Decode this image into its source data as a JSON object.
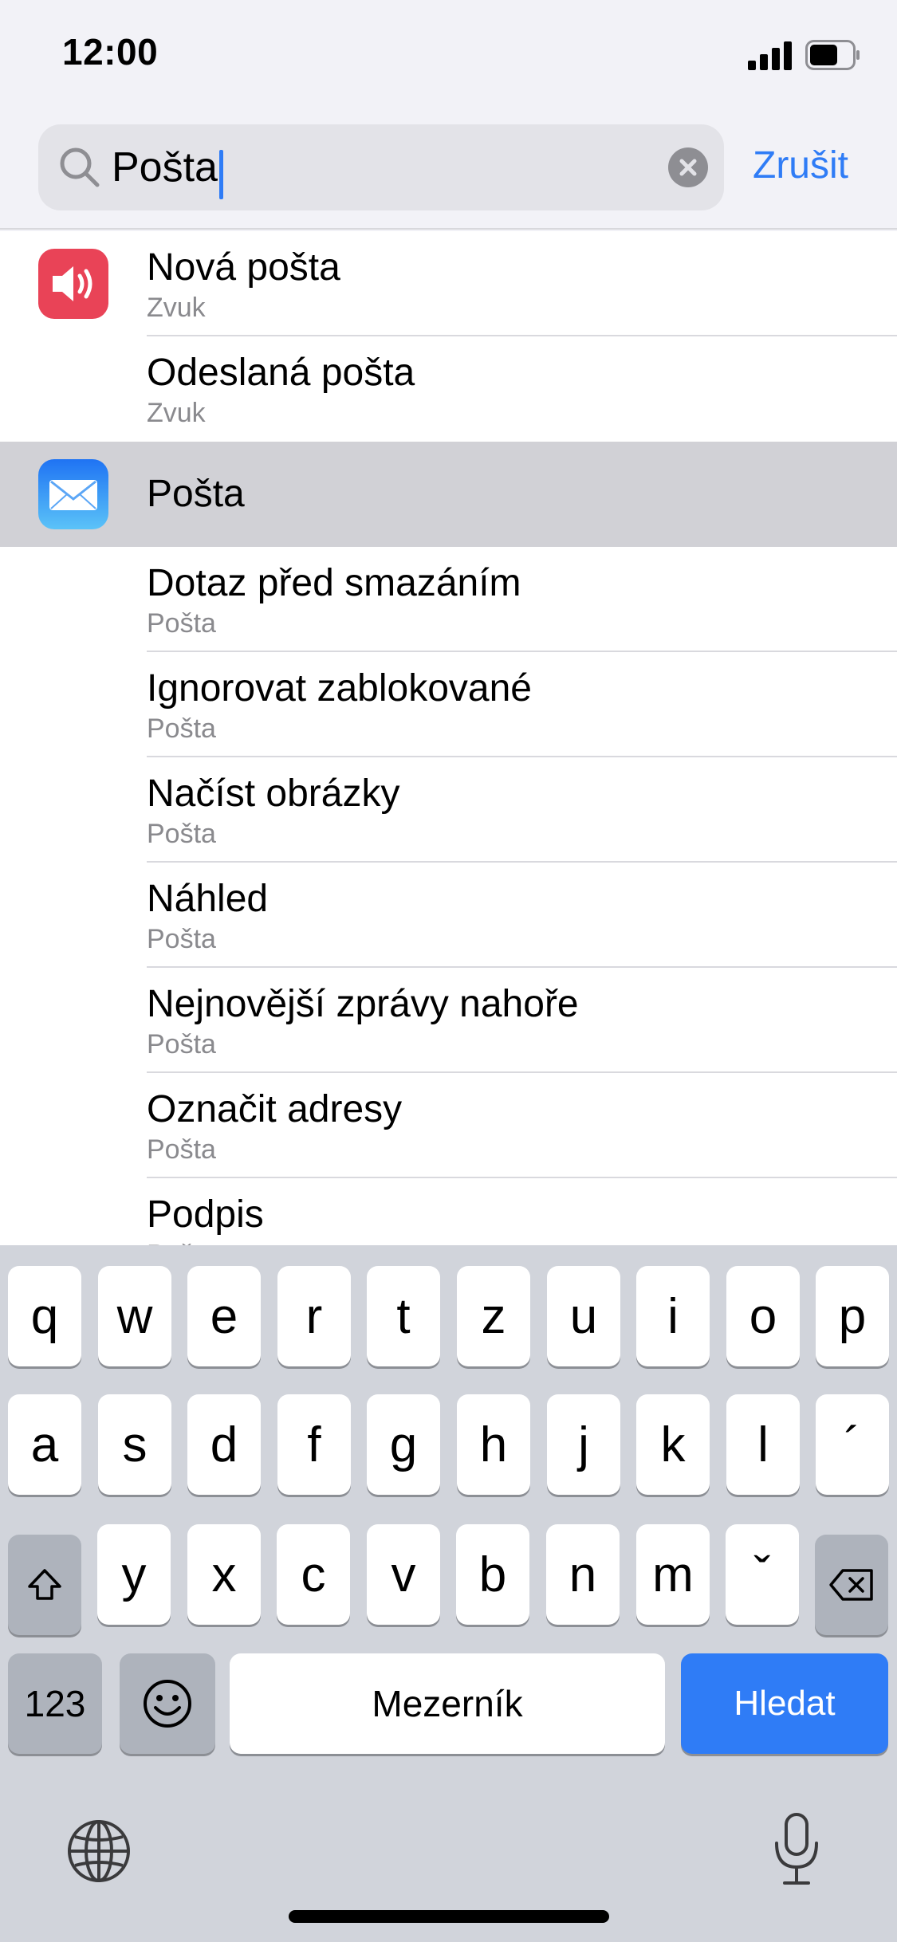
{
  "status_bar": {
    "time": "12:00"
  },
  "search": {
    "query": "Pošta",
    "cancel_label": "Zrušit"
  },
  "results": [
    {
      "title": "Nová pošta",
      "subtitle": "Zvuk",
      "icon": "speaker-icon"
    },
    {
      "title": "Odeslaná pošta",
      "subtitle": "Zvuk"
    },
    {
      "title": "Pošta",
      "icon": "mail-icon",
      "selected": true
    },
    {
      "title": "Dotaz před smazáním",
      "subtitle": "Pošta"
    },
    {
      "title": "Ignorovat zablokované",
      "subtitle": "Pošta"
    },
    {
      "title": "Načíst obrázky",
      "subtitle": "Pošta"
    },
    {
      "title": "Náhled",
      "subtitle": "Pošta"
    },
    {
      "title": "Nejnovější zprávy nahoře",
      "subtitle": "Pošta"
    },
    {
      "title": "Označit adresy",
      "subtitle": "Pošta"
    },
    {
      "title": "Podpis",
      "subtitle": "Pošta"
    }
  ],
  "keyboard": {
    "row1": [
      "q",
      "w",
      "e",
      "r",
      "t",
      "z",
      "u",
      "i",
      "o",
      "p"
    ],
    "row2": [
      "a",
      "s",
      "d",
      "f",
      "g",
      "h",
      "j",
      "k",
      "l",
      "´"
    ],
    "row3": [
      "y",
      "x",
      "c",
      "v",
      "b",
      "n",
      "m",
      "ˇ"
    ],
    "numbers_label": "123",
    "space_label": "Mezerník",
    "search_label": "Hledat"
  },
  "colors": {
    "accent": "#2f7cf6",
    "sound_icon": "#e94357",
    "selected_row": "#d1d1d6"
  }
}
